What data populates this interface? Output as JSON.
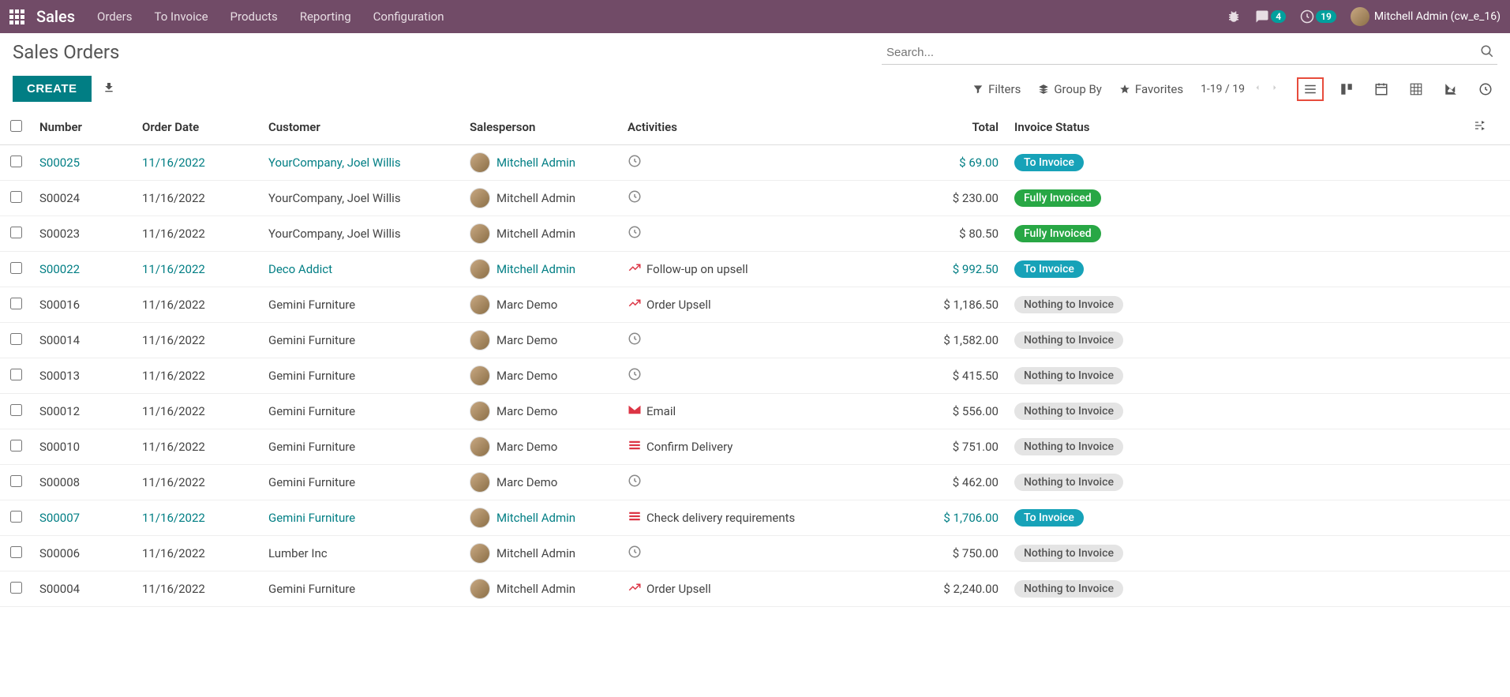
{
  "navbar": {
    "brand": "Sales",
    "menu": [
      "Orders",
      "To Invoice",
      "Products",
      "Reporting",
      "Configuration"
    ],
    "messages_count": "4",
    "activities_count": "19",
    "user": "Mitchell Admin (cw_e_16)"
  },
  "page": {
    "title": "Sales Orders",
    "create_label": "CREATE",
    "search_placeholder": "Search...",
    "filters_label": "Filters",
    "groupby_label": "Group By",
    "favorites_label": "Favorites",
    "pager": "1-19 / 19"
  },
  "columns": {
    "number": "Number",
    "order_date": "Order Date",
    "customer": "Customer",
    "salesperson": "Salesperson",
    "activities": "Activities",
    "total": "Total",
    "invoice_status": "Invoice Status"
  },
  "status_labels": {
    "to_invoice": "To Invoice",
    "fully_invoiced": "Fully Invoiced",
    "nothing": "Nothing to Invoice"
  },
  "rows": [
    {
      "number": "S00025",
      "date": "11/16/2022",
      "customer": "YourCompany, Joel Willis",
      "salesperson": "Mitchell Admin",
      "activity_type": "clock",
      "activity_text": "",
      "total": "$ 69.00",
      "status": "to_invoice",
      "highlight": true
    },
    {
      "number": "S00024",
      "date": "11/16/2022",
      "customer": "YourCompany, Joel Willis",
      "salesperson": "Mitchell Admin",
      "activity_type": "clock",
      "activity_text": "",
      "total": "$ 230.00",
      "status": "fully_invoiced",
      "highlight": false
    },
    {
      "number": "S00023",
      "date": "11/16/2022",
      "customer": "YourCompany, Joel Willis",
      "salesperson": "Mitchell Admin",
      "activity_type": "clock",
      "activity_text": "",
      "total": "$ 80.50",
      "status": "fully_invoiced",
      "highlight": false
    },
    {
      "number": "S00022",
      "date": "11/16/2022",
      "customer": "Deco Addict",
      "salesperson": "Mitchell Admin",
      "activity_type": "upsell",
      "activity_text": "Follow-up on upsell",
      "total": "$ 992.50",
      "status": "to_invoice",
      "highlight": true
    },
    {
      "number": "S00016",
      "date": "11/16/2022",
      "customer": "Gemini Furniture",
      "salesperson": "Marc Demo",
      "activity_type": "upsell",
      "activity_text": "Order Upsell",
      "total": "$ 1,186.50",
      "status": "nothing",
      "highlight": false
    },
    {
      "number": "S00014",
      "date": "11/16/2022",
      "customer": "Gemini Furniture",
      "salesperson": "Marc Demo",
      "activity_type": "clock",
      "activity_text": "",
      "total": "$ 1,582.00",
      "status": "nothing",
      "highlight": false
    },
    {
      "number": "S00013",
      "date": "11/16/2022",
      "customer": "Gemini Furniture",
      "salesperson": "Marc Demo",
      "activity_type": "clock",
      "activity_text": "",
      "total": "$ 415.50",
      "status": "nothing",
      "highlight": false
    },
    {
      "number": "S00012",
      "date": "11/16/2022",
      "customer": "Gemini Furniture",
      "salesperson": "Marc Demo",
      "activity_type": "email",
      "activity_text": "Email",
      "total": "$ 556.00",
      "status": "nothing",
      "highlight": false
    },
    {
      "number": "S00010",
      "date": "11/16/2022",
      "customer": "Gemini Furniture",
      "salesperson": "Marc Demo",
      "activity_type": "task",
      "activity_text": "Confirm Delivery",
      "total": "$ 751.00",
      "status": "nothing",
      "highlight": false
    },
    {
      "number": "S00008",
      "date": "11/16/2022",
      "customer": "Gemini Furniture",
      "salesperson": "Marc Demo",
      "activity_type": "clock",
      "activity_text": "",
      "total": "$ 462.00",
      "status": "nothing",
      "highlight": false
    },
    {
      "number": "S00007",
      "date": "11/16/2022",
      "customer": "Gemini Furniture",
      "salesperson": "Mitchell Admin",
      "activity_type": "task",
      "activity_text": "Check delivery requirements",
      "total": "$ 1,706.00",
      "status": "to_invoice",
      "highlight": true
    },
    {
      "number": "S00006",
      "date": "11/16/2022",
      "customer": "Lumber Inc",
      "salesperson": "Mitchell Admin",
      "activity_type": "clock",
      "activity_text": "",
      "total": "$ 750.00",
      "status": "nothing",
      "highlight": false
    },
    {
      "number": "S00004",
      "date": "11/16/2022",
      "customer": "Gemini Furniture",
      "salesperson": "Mitchell Admin",
      "activity_type": "upsell",
      "activity_text": "Order Upsell",
      "total": "$ 2,240.00",
      "status": "nothing",
      "highlight": false
    }
  ]
}
